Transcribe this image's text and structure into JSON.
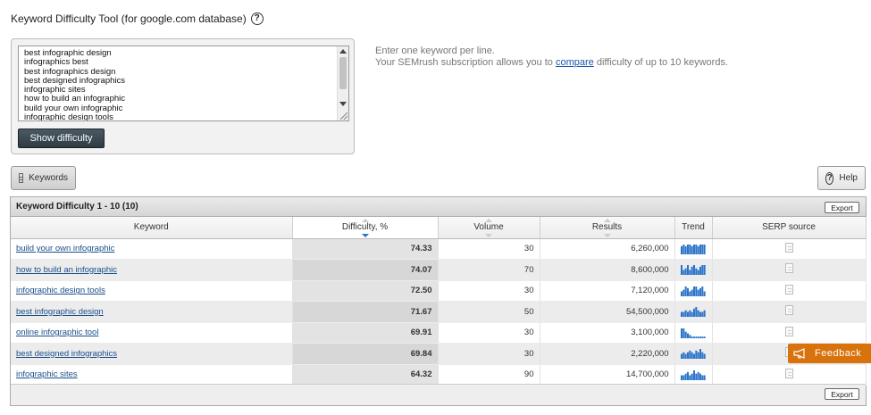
{
  "page": {
    "title": "Keyword Difficulty Tool (for google.com database)",
    "help_glyph": "?"
  },
  "input": {
    "keywords": [
      "best infographic design",
      "infographics best",
      "best infographics design",
      "best designed infographics",
      "infographic sites",
      "how to build an infographic",
      "build your own infographic",
      "infographic design tools"
    ],
    "show_button_label": "Show difficulty"
  },
  "hint": {
    "line1": "Enter one keyword per line.",
    "line2_prefix": "Your SEMrush subscription allows you to ",
    "line2_link": "compare",
    "line2_suffix": " difficulty of up to 10 keywords."
  },
  "toolbar": {
    "keywords_tab_label": "Keywords",
    "help_label": "Help"
  },
  "table": {
    "title": "Keyword Difficulty 1 - 10 (10)",
    "export_label": "Export",
    "columns": [
      "Keyword",
      "Difficulty, %",
      "Volume",
      "Results",
      "Trend",
      "SERP source"
    ],
    "rows": [
      {
        "keyword": "build your own infographic",
        "difficulty": "74.33",
        "volume": "30",
        "results": "6,260,000",
        "trend": [
          5,
          6,
          5,
          6,
          6,
          5,
          6,
          6,
          5,
          6,
          6,
          6
        ]
      },
      {
        "keyword": "how to build an infographic",
        "difficulty": "74.07",
        "volume": "70",
        "results": "8,600,000",
        "trend": [
          6,
          3,
          4,
          6,
          3,
          5,
          6,
          4,
          3,
          5,
          6,
          6
        ]
      },
      {
        "keyword": "infographic design tools",
        "difficulty": "72.50",
        "volume": "30",
        "results": "7,120,000",
        "trend": [
          3,
          4,
          6,
          5,
          3,
          4,
          6,
          6,
          4,
          5,
          6,
          3
        ]
      },
      {
        "keyword": "best infographic design",
        "difficulty": "71.67",
        "volume": "50",
        "results": "54,500,000",
        "trend": [
          3,
          3,
          4,
          3,
          4,
          3,
          5,
          6,
          4,
          3,
          3,
          4
        ]
      },
      {
        "keyword": "online infographic tool",
        "difficulty": "69.91",
        "volume": "30",
        "results": "3,100,000",
        "trend": [
          6,
          6,
          4,
          3,
          2,
          1,
          1,
          1,
          1,
          1,
          1,
          1
        ]
      },
      {
        "keyword": "best designed infographics",
        "difficulty": "69.84",
        "volume": "30",
        "results": "2,220,000",
        "trend": [
          3,
          4,
          3,
          4,
          5,
          4,
          3,
          5,
          4,
          6,
          4,
          3
        ]
      },
      {
        "keyword": "infographic sites",
        "difficulty": "64.32",
        "volume": "90",
        "results": "14,700,000",
        "trend": [
          3,
          3,
          4,
          5,
          3,
          4,
          6,
          4,
          5,
          4,
          3,
          3
        ]
      }
    ]
  },
  "feedback": {
    "label": "Feedback"
  },
  "colors": {
    "link": "#1a4e8a",
    "trend_bar": "#2b73c9",
    "feedback_bg": "#d8720c",
    "button_dark": "#2e3b43"
  }
}
